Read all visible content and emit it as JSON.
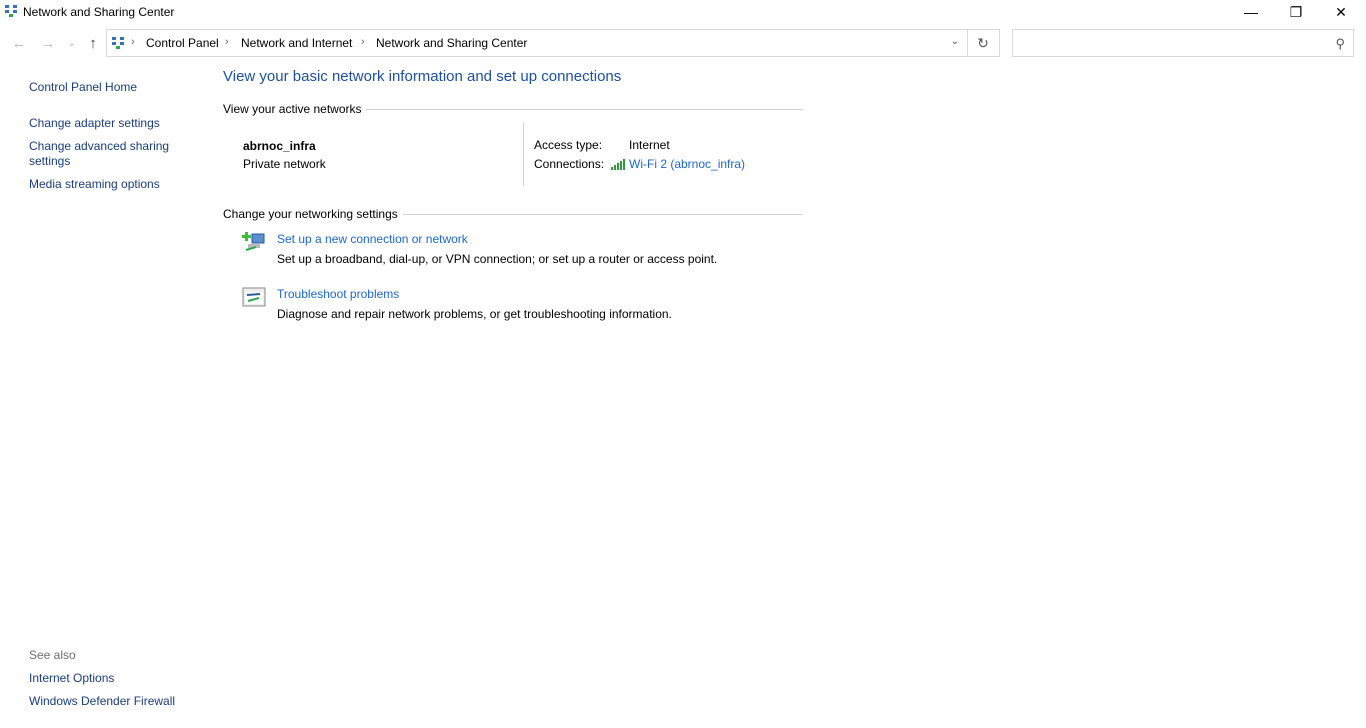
{
  "window": {
    "title": "Network and Sharing Center",
    "controls": [
      "minimize",
      "restore",
      "close"
    ]
  },
  "navigation": {
    "back_label": "←",
    "forward_label": "→",
    "recent_label": "⌄",
    "up_label": "↑",
    "breadcrumbs": [
      "Control Panel",
      "Network and Internet",
      "Network and Sharing Center"
    ],
    "refresh_label": "↻",
    "search_placeholder": ""
  },
  "sidebar": {
    "items": [
      "Control Panel Home",
      "Change adapter settings",
      "Change advanced sharing",
      "settings",
      "Media streaming options"
    ],
    "see_also_label": "See also",
    "see_also": [
      "Internet Options",
      "Windows Defender Firewall"
    ]
  },
  "main": {
    "heading": "View your basic network information and set up connections",
    "active_networks_label": "View your active networks",
    "network": {
      "name": "abrnoc_infra",
      "type": "Private network",
      "access_type_label": "Access type:",
      "access_type": "Internet",
      "connections_label": "Connections:",
      "connection": "Wi-Fi 2 (abrnoc_infra)"
    },
    "change_settings_label": "Change your networking settings",
    "tasks": [
      {
        "title": "Set up a new connection or network",
        "desc": "Set up a broadband, dial-up, or VPN connection; or set up a router or access point."
      },
      {
        "title": "Troubleshoot problems",
        "desc": "Diagnose and repair network problems, or get troubleshooting information."
      }
    ]
  }
}
